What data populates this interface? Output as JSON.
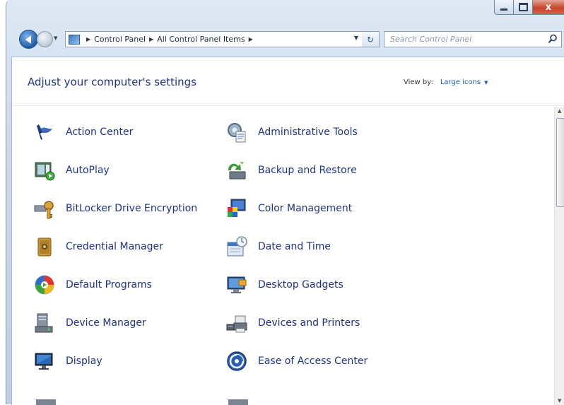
{
  "window": {
    "caption": {
      "minimize": "minimize",
      "maximize": "maximize",
      "close": "x"
    }
  },
  "nav": {
    "breadcrumb": [
      "Control Panel",
      "All Control Panel Items"
    ],
    "search_placeholder": "Search Control Panel"
  },
  "header": {
    "title": "Adjust your computer's settings",
    "view_by_label": "View by:",
    "view_by_value": "Large icons"
  },
  "items": [
    {
      "label": "Action Center",
      "icon": "flag-icon"
    },
    {
      "label": "Administrative Tools",
      "icon": "admin-tools-icon"
    },
    {
      "label": "AutoPlay",
      "icon": "autoplay-icon"
    },
    {
      "label": "Backup and Restore",
      "icon": "backup-icon"
    },
    {
      "label": "BitLocker Drive Encryption",
      "icon": "bitlocker-key-icon"
    },
    {
      "label": "Color Management",
      "icon": "color-management-icon"
    },
    {
      "label": "Credential Manager",
      "icon": "credential-vault-icon"
    },
    {
      "label": "Date and Time",
      "icon": "date-time-icon"
    },
    {
      "label": "Default Programs",
      "icon": "default-programs-icon"
    },
    {
      "label": "Desktop Gadgets",
      "icon": "desktop-gadgets-icon"
    },
    {
      "label": "Device Manager",
      "icon": "device-manager-icon"
    },
    {
      "label": "Devices and Printers",
      "icon": "printer-icon"
    },
    {
      "label": "Display",
      "icon": "display-monitor-icon"
    },
    {
      "label": "Ease of Access Center",
      "icon": "ease-of-access-icon"
    }
  ],
  "colors": {
    "link": "#1e3287",
    "accent": "#1a5fb4",
    "close_button": "#c5452b"
  }
}
